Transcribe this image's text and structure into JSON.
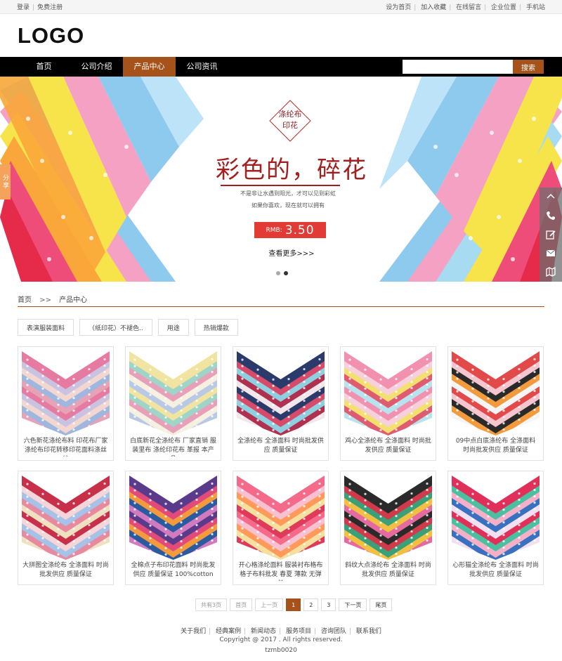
{
  "topbar": {
    "login": "登录",
    "register": "免费注册",
    "right": [
      "设为首页",
      "加入收藏",
      "在线留言",
      "企业位置",
      "手机站"
    ]
  },
  "logo": "LOGO",
  "nav": {
    "items": [
      "首页",
      "公司介绍",
      "产品中心",
      "公司资讯"
    ],
    "active_index": 2,
    "search_placeholder": "",
    "search_button": "搜索"
  },
  "banner": {
    "badge": [
      "涤纶布",
      "印花"
    ],
    "headline": "彩色的，碎花",
    "sub1": "不是非让水遇到阳光，才可以见到彩虹",
    "sub2": "如果你喜欢，现在就可以拥有",
    "price_currency": "RMB:",
    "price_value": "3.50",
    "more": "查看更多>>>",
    "slides": 2,
    "active_slide": 1,
    "share": "分享"
  },
  "side_tools": [
    "chevron-up-icon",
    "phone-icon",
    "edit-icon",
    "mail-icon",
    "map-icon",
    "chevron-down-icon"
  ],
  "breadcrumb": {
    "home": "首页",
    "arrow": ">>",
    "current": "产品中心"
  },
  "filters": [
    "表演服装面料",
    "（纸印花）不褪色..",
    "用途",
    "热销爆款"
  ],
  "products": [
    {
      "title": "六色新花涤纶布料 印花布厂家涤纶布印花转移印花面料涤丝纺",
      "palette": [
        "#e77aa0",
        "#c9c2e0",
        "#f2d6d0",
        "#9fb7de",
        "#e7a3b6"
      ]
    },
    {
      "title": "白底新花全涤纶布 厂家直销 服装里布 涤纶印花布 革报 本产品",
      "palette": [
        "#f1e3a0",
        "#9fd4c8",
        "#e7a0b8",
        "#f5f0e0",
        "#b8c9e6"
      ]
    },
    {
      "title": "全涤纶布 全涤面料 时尚批发供应 质量保证",
      "palette": [
        "#2a3a6a",
        "#d84a6a",
        "#8fd0e0",
        "#b03050",
        "#f2e6ea"
      ]
    },
    {
      "title": "鸡心全涤纶布 全涤面料 时尚批发供应 质量保证",
      "palette": [
        "#f290b0",
        "#f6d0dc",
        "#f4e070",
        "#e05a70",
        "#b7e2ee"
      ]
    },
    {
      "title": "09中点白底涤纶布 全涤面料 时尚批发供应 质量保证",
      "palette": [
        "#e24a4a",
        "#f5c6d0",
        "#2a2a2a",
        "#f39a3c",
        "#f5f5f5"
      ]
    },
    {
      "title": "大拼图全涤纶布 全涤面料 时尚批发供应 质量保证",
      "palette": [
        "#c8304a",
        "#f5d5d8",
        "#a6c2e8",
        "#e78aa0",
        "#efe0c0"
      ]
    },
    {
      "title": "全棉点子布印花面料 时尚批发供应 质量保证 100%cotton",
      "palette": [
        "#5a3a8a",
        "#e24a7a",
        "#f39a3c",
        "#2a5aa0",
        "#d07ac0"
      ]
    },
    {
      "title": "开心格涤纶面料 服装衬布格布格子布料批发 春夏 薄款 无弹 羊",
      "palette": [
        "#f46a8a",
        "#f8c0d0",
        "#ff9a5a",
        "#f5e0a0",
        "#e03a5a"
      ]
    },
    {
      "title": "斜纹大点涤纶布 全涤面料 时尚批发供应 质量保证",
      "palette": [
        "#2a2a2a",
        "#d03a4a",
        "#3aa07a",
        "#f2c040",
        "#e46aa0"
      ]
    },
    {
      "title": "心形猫全涤纶布 全涤面料 时尚批发供应 质量保证",
      "palette": [
        "#e0305a",
        "#4ac0a0",
        "#f5b0c8",
        "#3a70c0",
        "#f0e0f0"
      ]
    }
  ],
  "pagination": {
    "total": "共有3页",
    "first": "首页",
    "prev": "上一页",
    "pages": [
      "1",
      "2",
      "3"
    ],
    "current": "1",
    "next": "下一页",
    "last": "尾页"
  },
  "footer": {
    "links": [
      "关于我们",
      "经典案例",
      "新闻动态",
      "服务项目",
      "咨询团队",
      "联系我们"
    ],
    "copyright": "Copyright @ 2017 . All rights reserved.",
    "code": "tzmb0020"
  },
  "colors": {
    "accent": "#a6531b",
    "nav_bg": "#000000",
    "price_red": "#e23a35",
    "headline_red": "#a32020"
  }
}
